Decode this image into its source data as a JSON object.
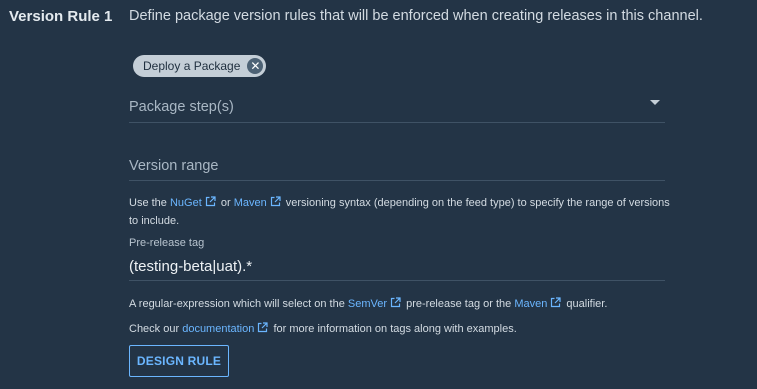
{
  "rule": {
    "title": "Version Rule 1",
    "description": "Define package version rules that will be enforced when creating releases in this channel."
  },
  "package_steps": {
    "selected_chip": "Deploy a Package",
    "placeholder": "Package step(s)"
  },
  "version_range": {
    "placeholder": "Version range",
    "help_prefix": "Use the",
    "nuget_link": "NuGet",
    "or": "or",
    "maven_link": "Maven",
    "help_suffix": "versioning syntax (depending on the feed type) to specify the range of versions to include."
  },
  "prerelease_tag": {
    "label": "Pre-release tag",
    "value": "(testing-beta|uat).*",
    "help_prefix": "A regular-expression which will select on the",
    "semver_link": "SemVer",
    "help_middle": "pre-release tag or the",
    "maven_link": "Maven",
    "help_suffix": "qualifier.",
    "docs_prefix": "Check our",
    "docs_link": "documentation",
    "docs_suffix": "for more information on tags along with examples."
  },
  "design_rule_button": "DESIGN RULE",
  "colors": {
    "background": "#233446",
    "link": "#6bb6ff",
    "chip": "#c4ced7"
  }
}
